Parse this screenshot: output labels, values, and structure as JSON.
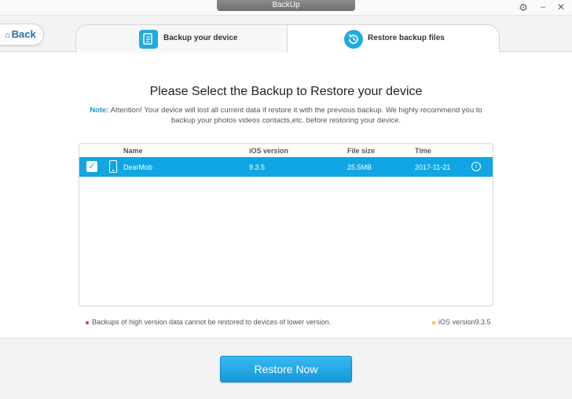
{
  "window": {
    "title": "BackUp"
  },
  "nav": {
    "back_label": "Back"
  },
  "tabs": [
    {
      "label": "Backup your device"
    },
    {
      "label": "Restore backup files"
    }
  ],
  "main": {
    "heading": "Please Select the Backup to Restore your device",
    "note_label": "Note:",
    "note_text": "Attention! Your device will lost all current data if restore it with the previous backup. We highly recommend you to backup your photos videos contacts,etc. before restoring your device."
  },
  "table": {
    "columns": [
      "Name",
      "iOS version",
      "File size",
      "Time"
    ],
    "rows": [
      {
        "name": "DearMob",
        "ios_version": "9.3.5",
        "file_size": "25.5MB",
        "time": "2017-11-21",
        "selected": true
      }
    ]
  },
  "footnotes": {
    "left": "Backups of high version data cannot be restored to devices of lower version.",
    "right": "iOS version9.3.5"
  },
  "actions": {
    "restore_label": "Restore Now"
  },
  "colors": {
    "accent": "#10a6e3",
    "red_dot": "#e53935",
    "yellow_dot": "#f5c518"
  }
}
